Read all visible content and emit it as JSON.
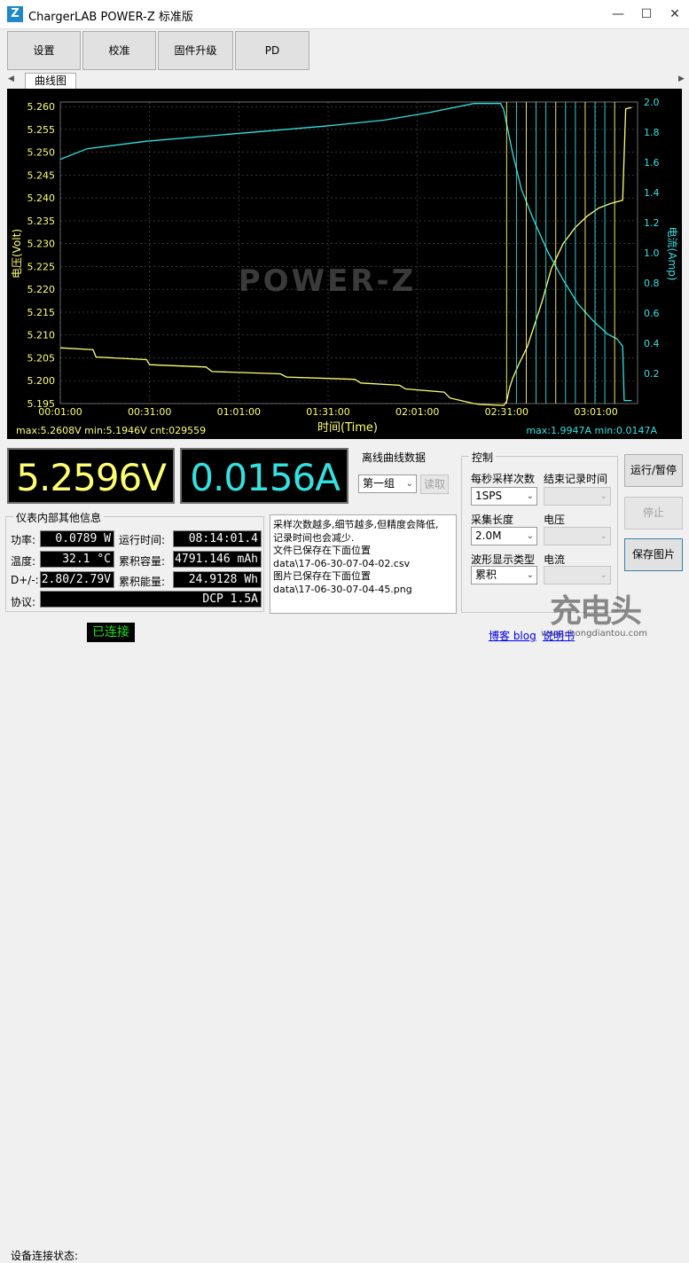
{
  "window": {
    "title": "ChargerLAB POWER-Z 标准版",
    "logo_letter": "Z"
  },
  "toolbar": {
    "settings": "设置",
    "calibrate": "校准",
    "firmware": "固件升级",
    "pd": "PD"
  },
  "tabs": [
    {
      "label": "曲线图"
    }
  ],
  "chart_data": {
    "type": "line",
    "title": "",
    "xlabel": "时间(Time)",
    "ylabel_left": "电压(Volt)",
    "ylabel_right": "电流(Amp)",
    "x_ticks": [
      "00:01:00",
      "00:31:00",
      "01:01:00",
      "01:31:00",
      "02:01:00",
      "02:31:00",
      "03:01:00"
    ],
    "y_left_ticks": [
      "5.195",
      "5.200",
      "5.205",
      "5.210",
      "5.215",
      "5.220",
      "5.225",
      "5.230",
      "5.235",
      "5.240",
      "5.245",
      "5.250",
      "5.255",
      "5.260"
    ],
    "y_right_ticks": [
      "0.2",
      "0.4",
      "0.6",
      "0.8",
      "1.0",
      "1.2",
      "1.4",
      "1.6",
      "1.8",
      "2.0"
    ],
    "ylim_left": [
      5.195,
      5.261
    ],
    "ylim_right": [
      0,
      2.0
    ],
    "xlim_minutes": [
      1,
      195
    ],
    "grid": true,
    "watermark": "POWER-Z",
    "footer_left": "max:5.2608V min:5.1946V cnt:029559",
    "footer_right": "max:1.9947A min:0.0147A",
    "series": [
      {
        "name": "电压(Volt)",
        "axis": "left",
        "color": "#ffff73",
        "x": [
          1,
          12,
          13,
          30,
          31,
          50,
          52,
          75,
          77,
          100,
          102,
          115,
          117,
          130,
          132,
          140,
          142,
          150,
          151,
          152,
          153,
          155,
          158,
          160,
          163,
          166,
          170,
          174,
          178,
          182,
          186,
          190,
          191,
          193
        ],
        "y": [
          5.2072,
          5.2068,
          5.2052,
          5.2046,
          5.2035,
          5.203,
          5.202,
          5.2015,
          5.2008,
          5.2003,
          5.1995,
          5.199,
          5.1982,
          5.1975,
          5.1962,
          5.195,
          5.1948,
          5.1946,
          5.1955,
          5.1985,
          5.2005,
          5.2035,
          5.2075,
          5.2115,
          5.2175,
          5.2245,
          5.23,
          5.2335,
          5.236,
          5.2378,
          5.2388,
          5.2395,
          5.2595,
          5.2598
        ]
      },
      {
        "name": "电流(Amp)",
        "axis": "right",
        "color": "#33e1e1",
        "x": [
          1,
          10,
          30,
          60,
          90,
          110,
          125,
          140,
          149,
          150,
          153,
          156,
          160,
          165,
          170,
          175,
          180,
          185,
          188,
          190,
          190.5,
          193
        ],
        "y": [
          1.62,
          1.69,
          1.74,
          1.79,
          1.84,
          1.88,
          1.93,
          1.99,
          1.99,
          1.95,
          1.66,
          1.42,
          1.22,
          1.0,
          0.82,
          0.66,
          0.55,
          0.46,
          0.43,
          0.38,
          0.02,
          0.02
        ]
      }
    ]
  },
  "readout": {
    "voltage": "5.2596V",
    "current": "0.0156A",
    "voltage_color": "#ffff73",
    "current_color": "#33e1e1"
  },
  "offline": {
    "title": "离线曲线数据",
    "group_value": "第一组",
    "read_button": "读取"
  },
  "control": {
    "title": "控制",
    "sample_rate_label": "每秒采样次数",
    "sample_rate_value": "1SPS",
    "end_record_label": "结束记录时间",
    "end_record_value": "",
    "length_label": "采集长度",
    "length_value": "2.0M",
    "voltage_label": "电压",
    "voltage_value": "",
    "waveform_label": "波形显示类型",
    "waveform_value": "累积",
    "current_label": "电流",
    "current_value": ""
  },
  "actions": {
    "run_pause": "运行/暂停",
    "stop": "停止",
    "save_image": "保存图片"
  },
  "info": {
    "title": "仪表内部其他信息",
    "power_label": "功率:",
    "power_value": "0.0789 W",
    "temp_label": "温度:",
    "temp_value": "32.1 °C",
    "dpdm_label": "D+/-:",
    "dpdm_value": "2.80/2.79V",
    "protocol_label": "协议:",
    "protocol_value": "DCP 1.5A",
    "runtime_label": "运行时间:",
    "runtime_value": "08:14:01.4",
    "capacity_label": "累积容量:",
    "capacity_value": "4791.146 mAh",
    "energy_label": "累积能量:",
    "energy_value": "24.9128 Wh"
  },
  "log": {
    "lines": [
      "采样次数越多,细节越多,但精度会降低,",
      "记录时间也会减少.",
      "文件已保存在下面位置",
      "data\\17-06-30-07-04-02.csv",
      "图片已保存在下面位置",
      "data\\17-06-30-07-04-45.png"
    ]
  },
  "status": {
    "label": "设备连接状态:",
    "value": "已连接",
    "blog_link": "博客 blog",
    "manual_link": "说明书"
  },
  "watermark": {
    "logo": "充电头",
    "url": "www.chongdiantou.com"
  }
}
